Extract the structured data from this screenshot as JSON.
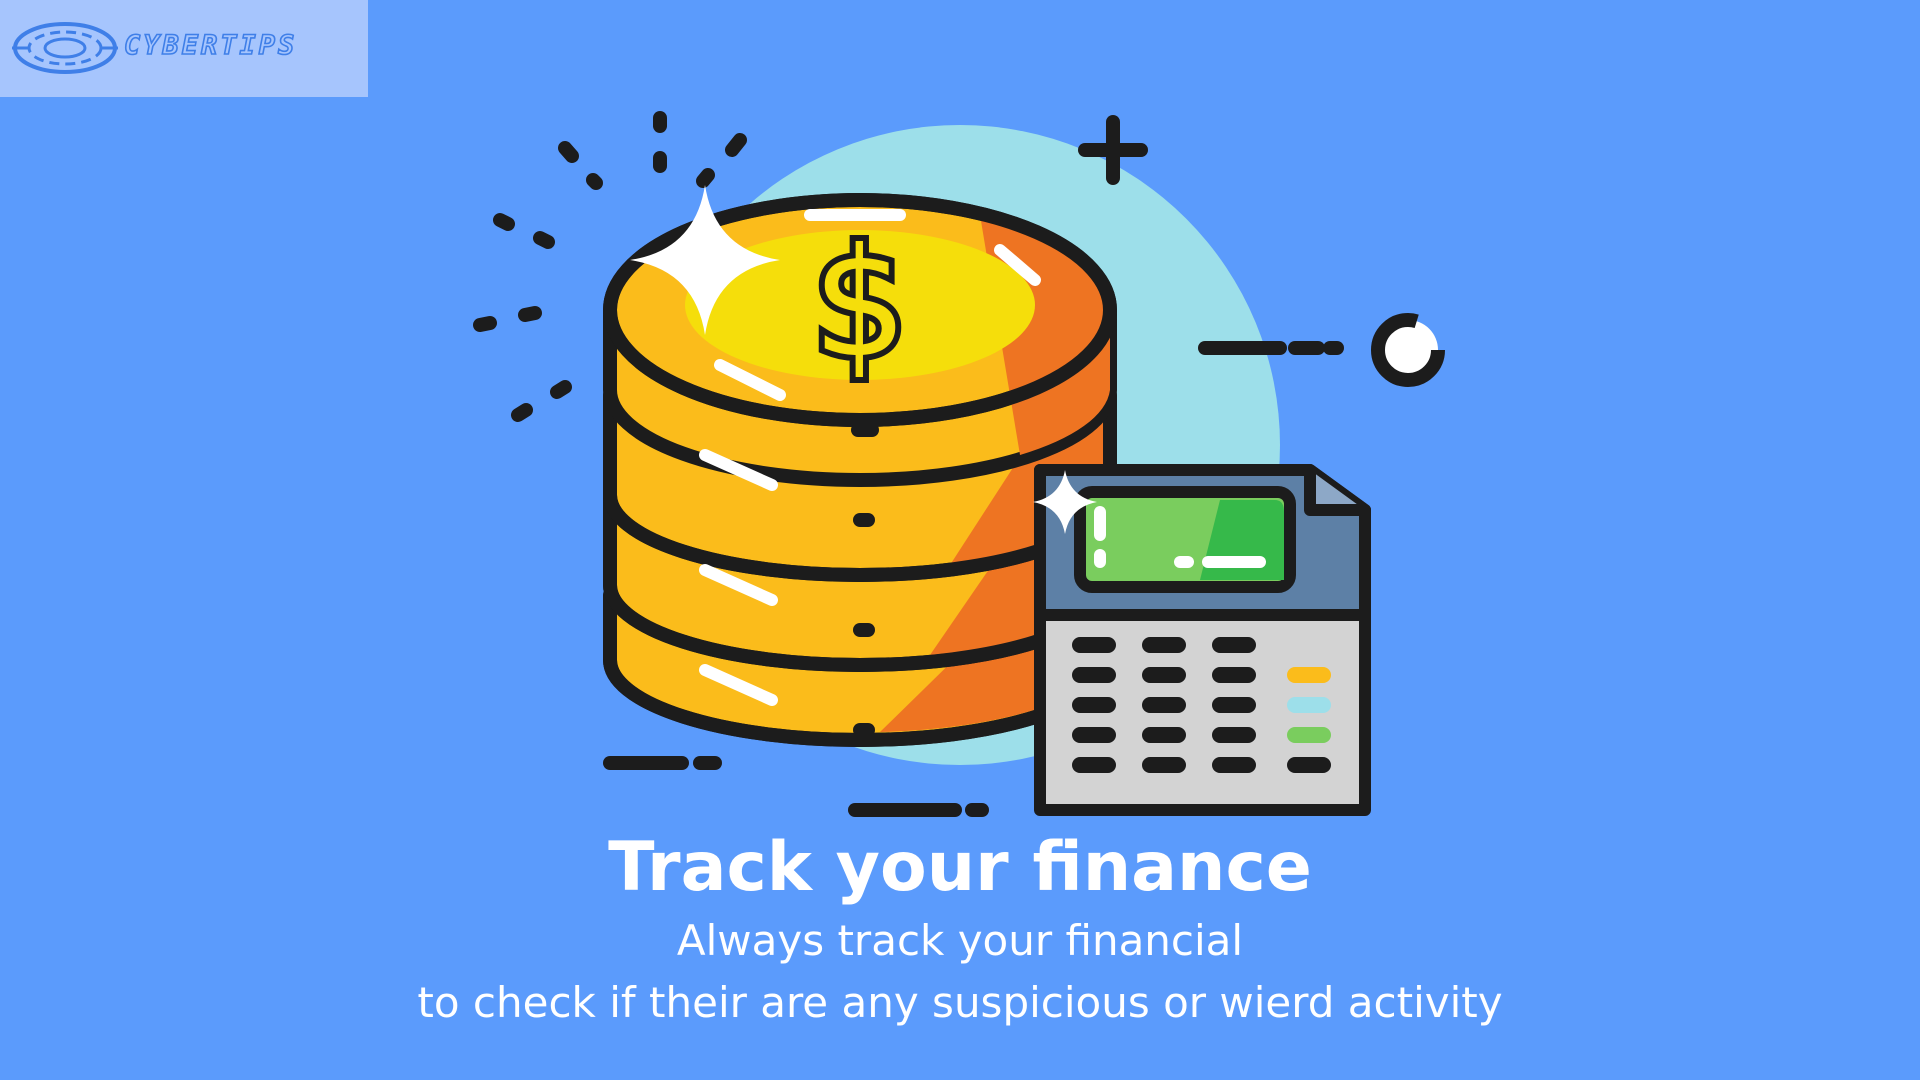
{
  "logo": {
    "text": "CYBERTIPS"
  },
  "heading": {
    "title": "Track your finance"
  },
  "body": {
    "line1": "Always track your financial",
    "line2": "to check if their are any suspicious or wierd activity"
  },
  "colors": {
    "background": "#5b9bfc",
    "logo_box": "#a6c5fd",
    "coin_yellow": "#fbbc1b",
    "coin_orange": "#ee7422",
    "coin_face": "#f5de0b",
    "circle_backdrop": "#9ddfea",
    "calculator_screen": "#7acd5e",
    "text": "#ffffff"
  },
  "icons": [
    "cybertips-logo-icon",
    "coin-stack-icon",
    "calculator-icon",
    "sparkle-icon",
    "plus-icon"
  ]
}
